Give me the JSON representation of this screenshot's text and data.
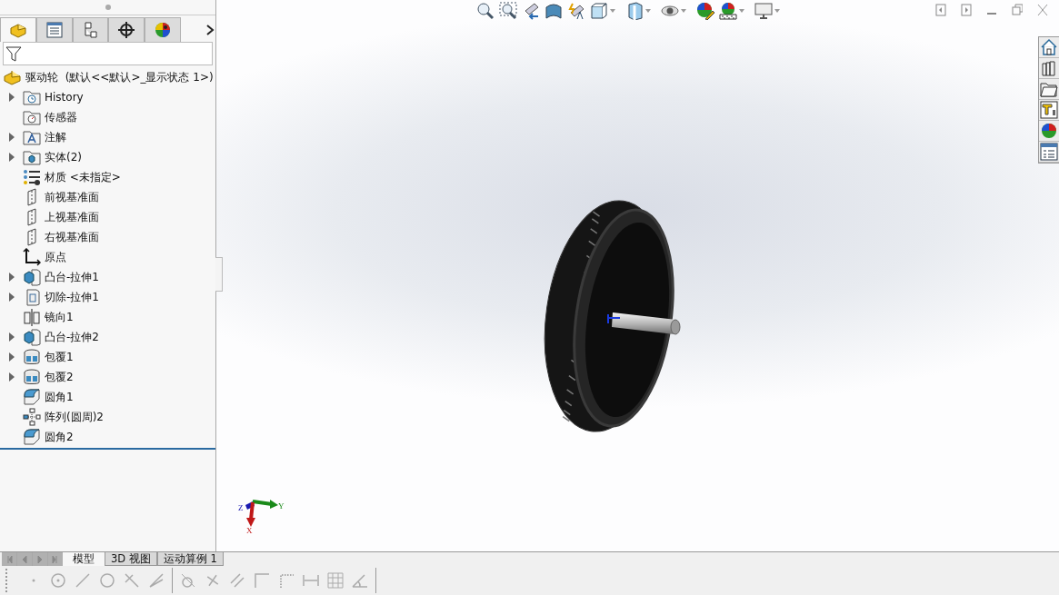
{
  "panel_tabs": [
    {
      "kind": "feature-manager",
      "selected": true
    },
    {
      "kind": "property-manager",
      "selected": false
    },
    {
      "kind": "configuration-manager",
      "selected": false
    },
    {
      "kind": "dimxpert",
      "selected": false
    },
    {
      "kind": "display-manager",
      "selected": false
    }
  ],
  "feature_tree": {
    "root": "驱动轮  (默认<<默认>_显示状态 1>)",
    "items": [
      {
        "label": "History",
        "kind": "history",
        "expandable": true
      },
      {
        "label": "传感器",
        "kind": "sensor",
        "expandable": false
      },
      {
        "label": "注解",
        "kind": "annotation",
        "expandable": true
      },
      {
        "label": "实体(2)",
        "kind": "solid",
        "expandable": true
      },
      {
        "label": "材质 <未指定>",
        "kind": "material",
        "expandable": false
      },
      {
        "label": "前视基准面",
        "kind": "plane",
        "expandable": false
      },
      {
        "label": "上视基准面",
        "kind": "plane",
        "expandable": false
      },
      {
        "label": "右视基准面",
        "kind": "plane",
        "expandable": false
      },
      {
        "label": "原点",
        "kind": "origin",
        "expandable": false
      },
      {
        "label": "凸台-拉伸1",
        "kind": "extrude",
        "expandable": true
      },
      {
        "label": "切除-拉伸1",
        "kind": "cut",
        "expandable": true
      },
      {
        "label": "镜向1",
        "kind": "mirror",
        "expandable": false
      },
      {
        "label": "凸台-拉伸2",
        "kind": "extrude",
        "expandable": true
      },
      {
        "label": "包覆1",
        "kind": "wrap",
        "expandable": true
      },
      {
        "label": "包覆2",
        "kind": "wrap",
        "expandable": true
      },
      {
        "label": "圆角1",
        "kind": "fillet",
        "expandable": false
      },
      {
        "label": "阵列(圆周)2",
        "kind": "pattern",
        "expandable": false
      },
      {
        "label": "圆角2",
        "kind": "fillet",
        "expandable": false
      }
    ]
  },
  "triad": {
    "x": "X",
    "y": "Y",
    "z": "Z"
  },
  "view_tabs": [
    {
      "label": "模型",
      "selected": true
    },
    {
      "label": "3D 视图",
      "selected": false
    },
    {
      "label": "运动算例 1",
      "selected": false
    }
  ]
}
